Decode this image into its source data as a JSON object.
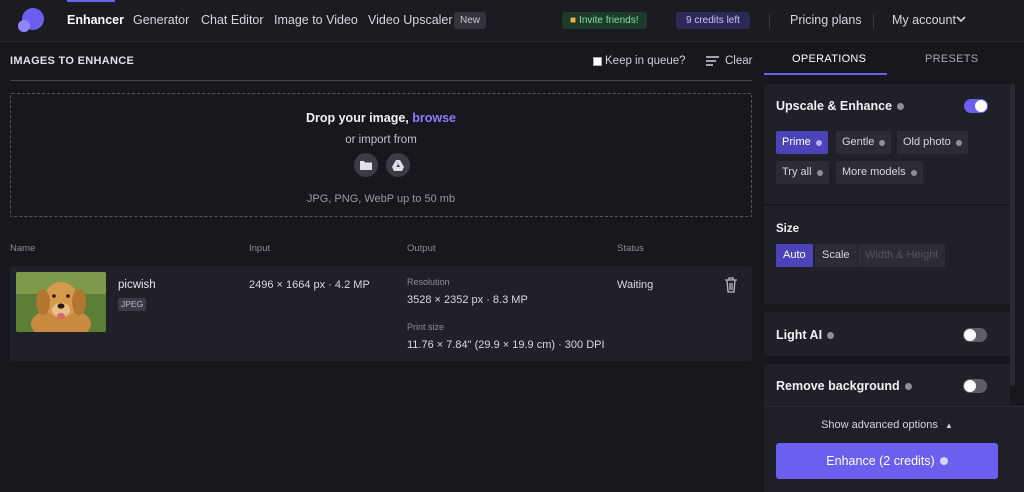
{
  "nav": {
    "items": [
      "Enhancer",
      "Generator",
      "Chat Editor",
      "Image to Video",
      "Video Upscaler"
    ],
    "new_badge": "New",
    "invite": "Invite friends!",
    "credits": "9 credits left",
    "pricing": "Pricing plans",
    "account": "My account"
  },
  "queue": {
    "title": "IMAGES TO ENHANCE",
    "keep_label": "Keep in queue?",
    "clear_label": "Clear"
  },
  "drop": {
    "title": "Drop your image,",
    "browse": "browse",
    "import_from": "or import from",
    "formats": "JPG, PNG, WebP up to 50 mb"
  },
  "table": {
    "headers": [
      "Name",
      "Input",
      "Output",
      "Status"
    ],
    "row": {
      "name": "picwish",
      "type": "JPEG",
      "input": "2496 × 1664 px · 4.2 MP",
      "resolution_label": "Resolution",
      "resolution": "3528 × 2352 px · 8.3 MP",
      "print_label": "Print size",
      "print_size": "11.76 × 7.84\" (29.9 × 19.9 cm) · 300 DPI",
      "status": "Waiting"
    }
  },
  "panel": {
    "tabs": [
      "OPERATIONS",
      "PRESETS"
    ],
    "upscale": {
      "title": "Upscale & Enhance",
      "enabled": true,
      "models": [
        "Prime",
        "Gentle",
        "Old photo",
        "Try all",
        "More models"
      ],
      "selected": "Prime"
    },
    "size": {
      "title": "Size",
      "options": [
        "Auto",
        "Scale",
        "Width & Height"
      ],
      "selected": "Auto"
    },
    "light_ai": {
      "title": "Light AI",
      "enabled": false
    },
    "remove_bg": {
      "title": "Remove background",
      "enabled": false
    },
    "advanced": "Show advanced options",
    "enhance_button": "Enhance (2 credits)"
  },
  "colors": {
    "accent": "#6b5ff0",
    "background": "#17171e",
    "card": "#202029"
  }
}
